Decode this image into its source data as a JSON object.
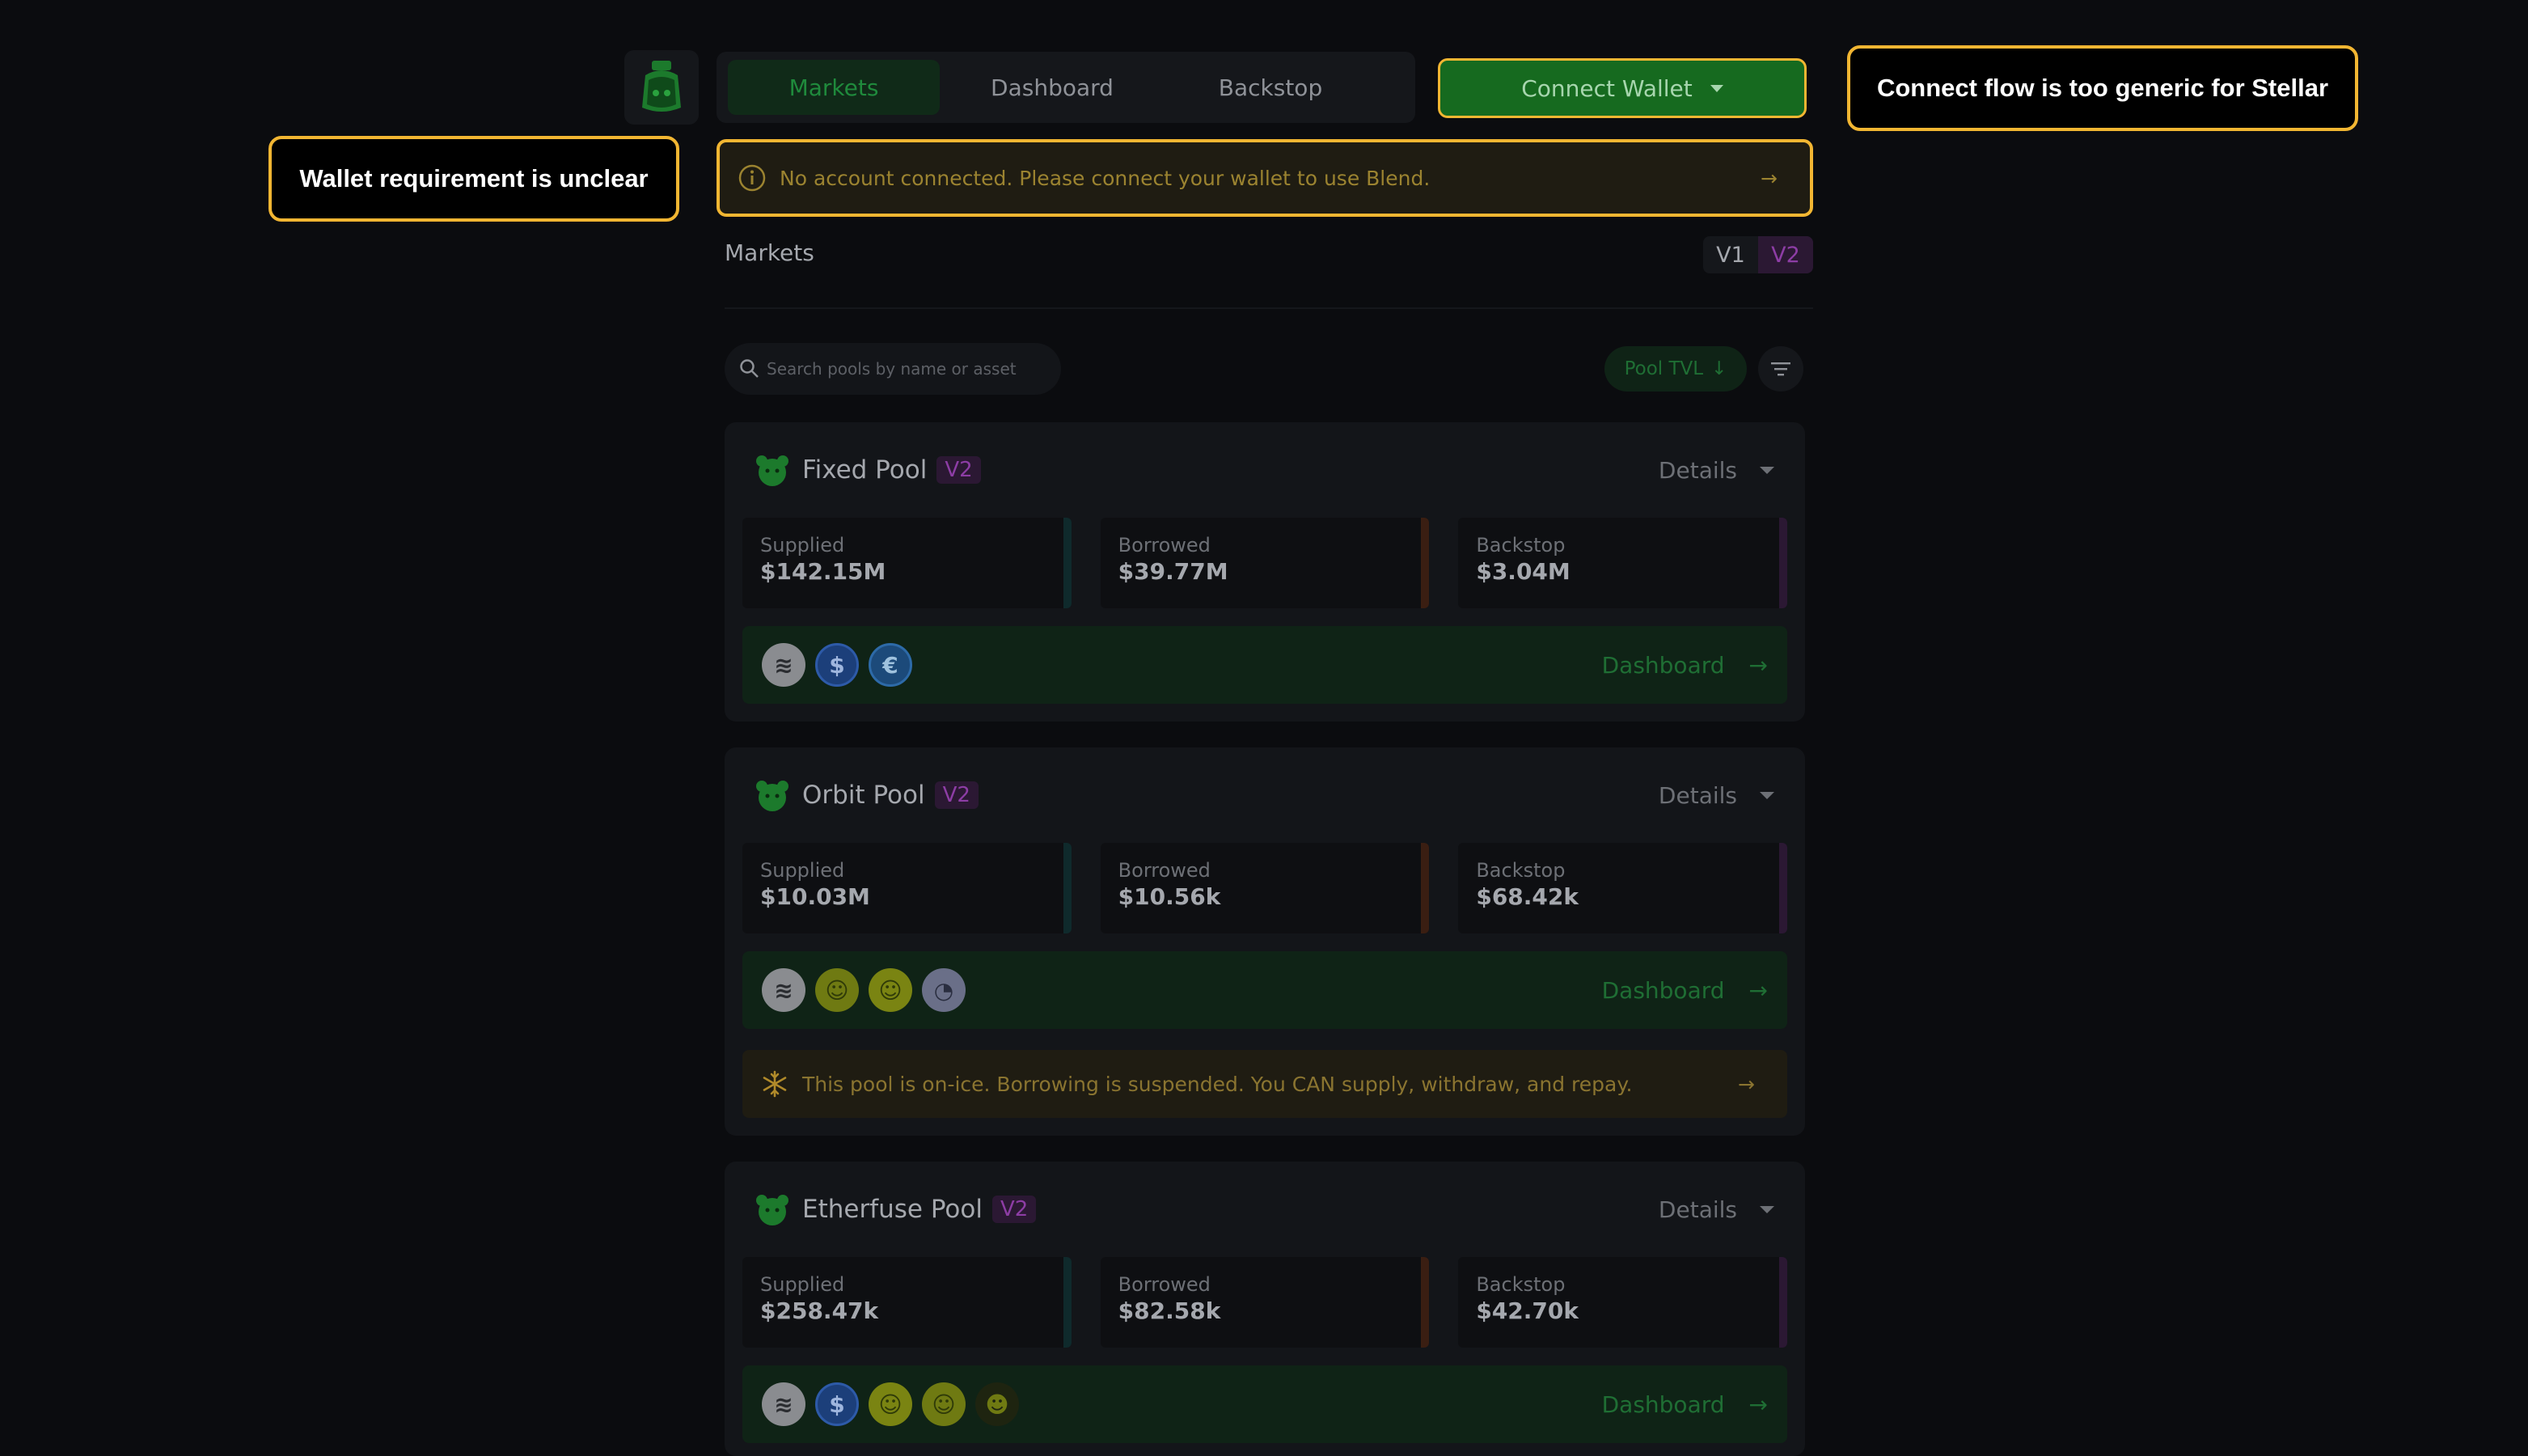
{
  "nav": {
    "tabs": [
      {
        "label": "Markets",
        "active": true
      },
      {
        "label": "Dashboard",
        "active": false
      },
      {
        "label": "Backstop",
        "active": false
      }
    ],
    "connect_label": "Connect Wallet"
  },
  "annotations": {
    "connect_flow": "Connect flow is too generic for Stellar",
    "wallet_requirement": "Wallet requirement is unclear"
  },
  "alert": {
    "text": "No account connected. Please connect your wallet to use Blend."
  },
  "markets": {
    "title": "Markets",
    "versions": [
      "V1",
      "V2"
    ],
    "selected_version": "V2"
  },
  "search": {
    "placeholder": "Search pools by name or asset"
  },
  "sort": {
    "label": "Pool TVL"
  },
  "pools": [
    {
      "name": "Fixed Pool",
      "version": "V2",
      "details_label": "Details",
      "supplied_label": "Supplied",
      "supplied": "$142.15M",
      "borrowed_label": "Borrowed",
      "borrowed": "$39.77M",
      "backstop_label": "Backstop",
      "backstop": "$3.04M",
      "dashboard_label": "Dashboard",
      "asset_icons": [
        "stellar-xlm-icon",
        "usdc-icon",
        "eurc-icon"
      ]
    },
    {
      "name": "Orbit Pool",
      "version": "V2",
      "details_label": "Details",
      "supplied_label": "Supplied",
      "supplied": "$10.03M",
      "borrowed_label": "Borrowed",
      "borrowed": "$10.56k",
      "backstop_label": "Backstop",
      "backstop": "$68.42k",
      "dashboard_label": "Dashboard",
      "asset_icons": [
        "stellar-xlm-icon",
        "token-portrait-icon",
        "token-portrait-icon",
        "token-swirl-icon"
      ],
      "ice_notice": "This pool is on-ice. Borrowing is suspended. You CAN supply, withdraw, and repay."
    },
    {
      "name": "Etherfuse Pool",
      "version": "V2",
      "details_label": "Details",
      "supplied_label": "Supplied",
      "supplied": "$258.47k",
      "borrowed_label": "Borrowed",
      "borrowed": "$82.58k",
      "backstop_label": "Backstop",
      "backstop": "$42.70k",
      "dashboard_label": "Dashboard",
      "asset_icons": [
        "stellar-xlm-icon",
        "usdc-icon",
        "token-portrait-icon",
        "token-portrait-icon",
        "token-dark-portrait-icon"
      ]
    }
  ],
  "colors": {
    "background": "#0b0c0f",
    "accent_green": "#166a1f",
    "callout_border": "#f2b632",
    "v2_purple": "#8d3da5",
    "supplied_bar": "#0f2a2c",
    "borrowed_bar": "#3a1e12",
    "backstop_bar": "#2b1833"
  }
}
